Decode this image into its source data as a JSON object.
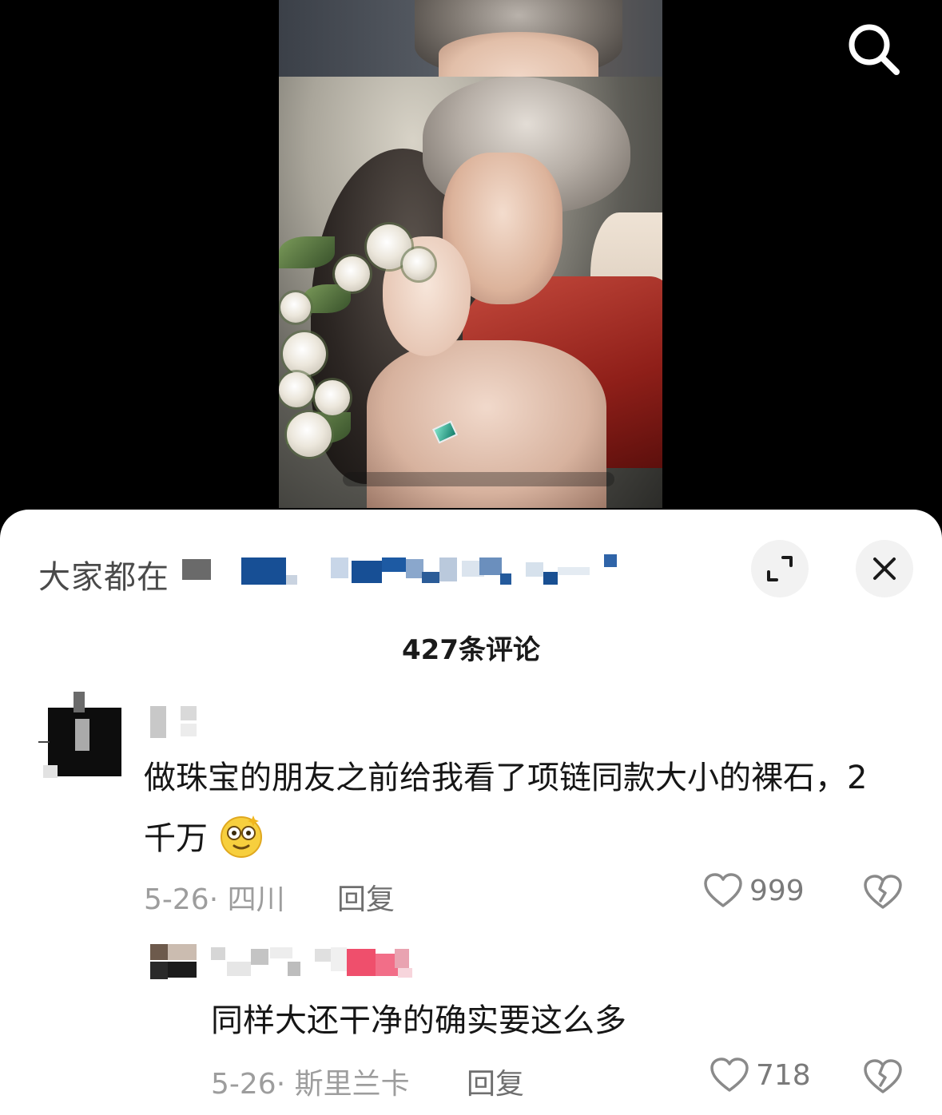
{
  "video": {
    "search_icon": "search-icon"
  },
  "sheet": {
    "title": "大家都在",
    "expand_icon": "expand-icon",
    "close_icon": "close-icon",
    "comment_count": "427条评论"
  },
  "comments": [
    {
      "text": "做珠宝的朋友之前给我看了项链同款大小的裸石，2千万",
      "emoji": "dizzy-face-emoji",
      "meta": "5-26· 四川",
      "reply_label": "回复",
      "likes": "999"
    },
    {
      "text": "同样大还干净的确实要这么多",
      "meta": "5-26· 斯里兰卡",
      "reply_label": "回复",
      "likes": "718"
    }
  ],
  "colors": {
    "sheet_bg": "#ffffff",
    "text_primary": "#161616",
    "text_secondary": "#9d9d9d",
    "icon_bg": "#f2f2f2",
    "mosaic_blue": "#1a4f8f",
    "mosaic_pink": "#ef4f6c"
  }
}
